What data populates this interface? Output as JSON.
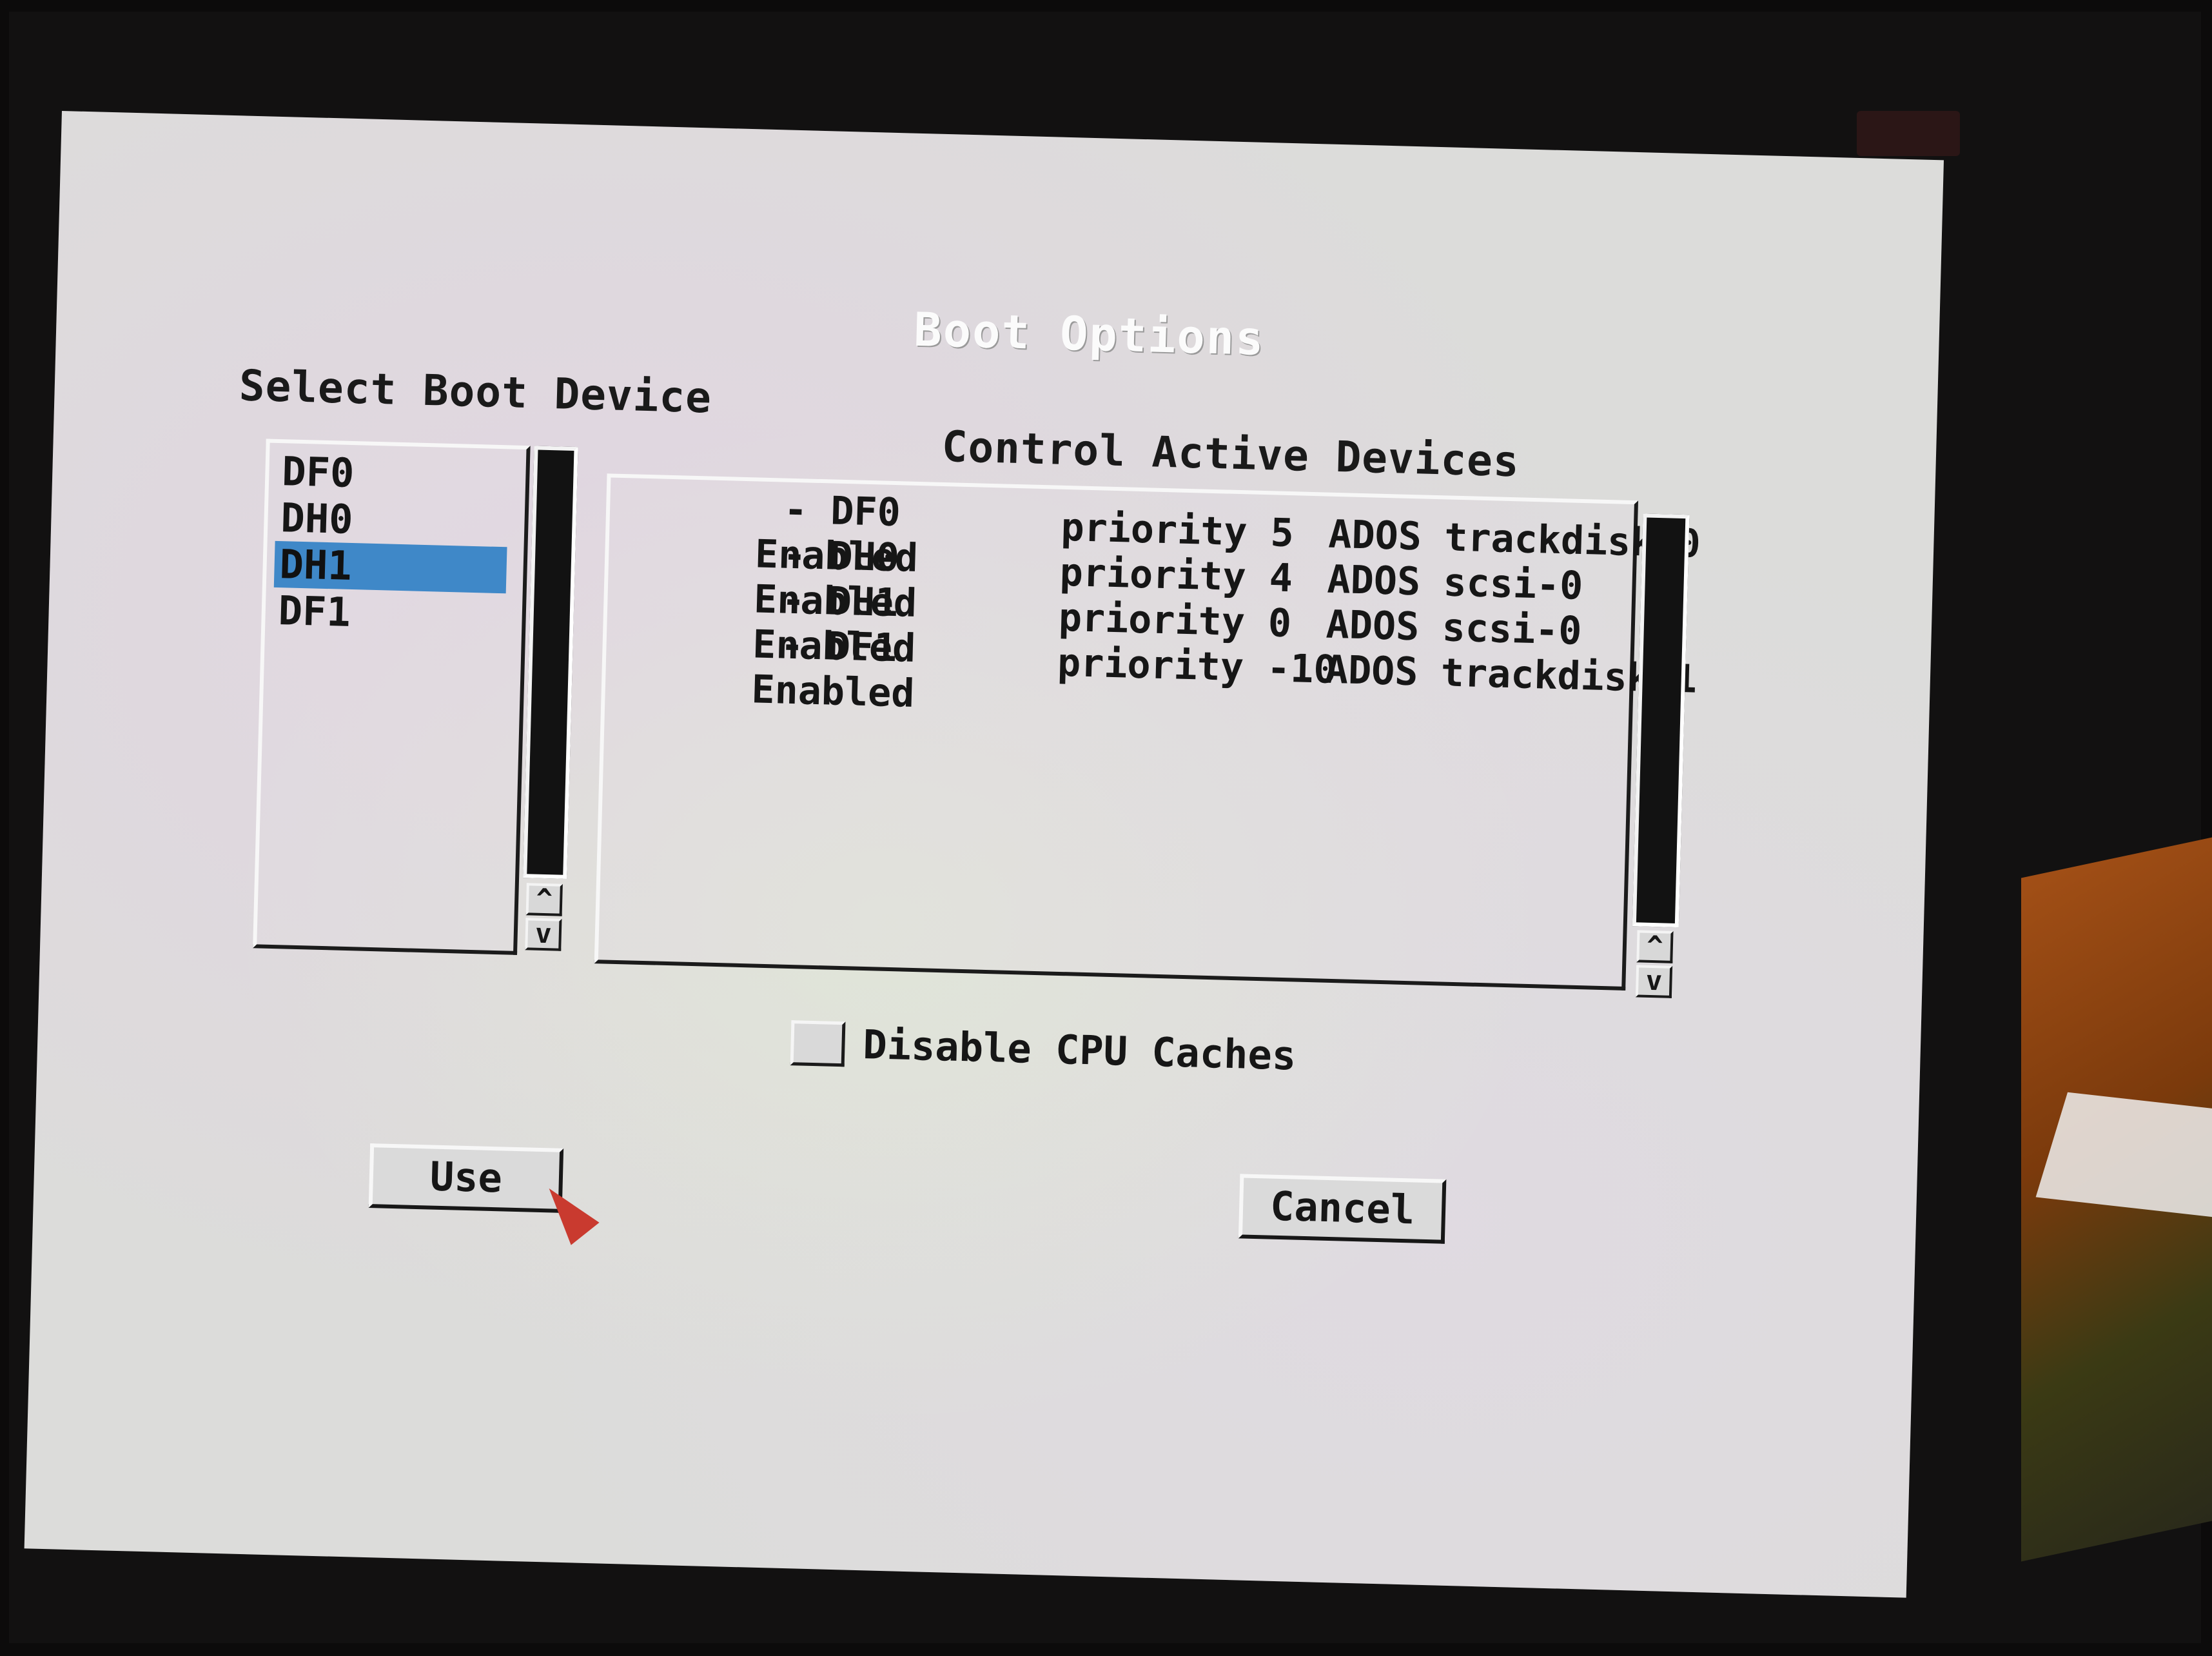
{
  "dialog": {
    "title": "Boot Options"
  },
  "boot_device": {
    "heading": "Select Boot Device",
    "items": [
      "DF0",
      "DH0",
      "DH1",
      "DF1"
    ],
    "selected": "DH1"
  },
  "active_devices": {
    "heading": "Control Active Devices",
    "rows": [
      {
        "status": "Enabled",
        "device": "- DF0",
        "priority": "priority 5",
        "fs": "ADOS",
        "driver": "trackdisk-0"
      },
      {
        "status": "Enabled",
        "device": "- DH0",
        "priority": "priority 4",
        "fs": "ADOS",
        "driver": "scsi-0"
      },
      {
        "status": "Enabled",
        "device": "- DH1",
        "priority": "priority 0",
        "fs": "ADOS",
        "driver": "scsi-0"
      },
      {
        "status": "Enabled",
        "device": "- DF1",
        "priority": "priority -10",
        "fs": "ADOS",
        "driver": "trackdisk-1"
      }
    ]
  },
  "options": {
    "disable_cpu_caches_label": "Disable CPU Caches",
    "disable_cpu_caches_checked": false
  },
  "buttons": {
    "use": "Use",
    "cancel": "Cancel"
  },
  "scroll_arrows": {
    "up": "^",
    "down": "v"
  },
  "colors": {
    "selection": "#3f88c8",
    "pointer": "#c93a2f",
    "screen_bg": "#dcdcda"
  }
}
